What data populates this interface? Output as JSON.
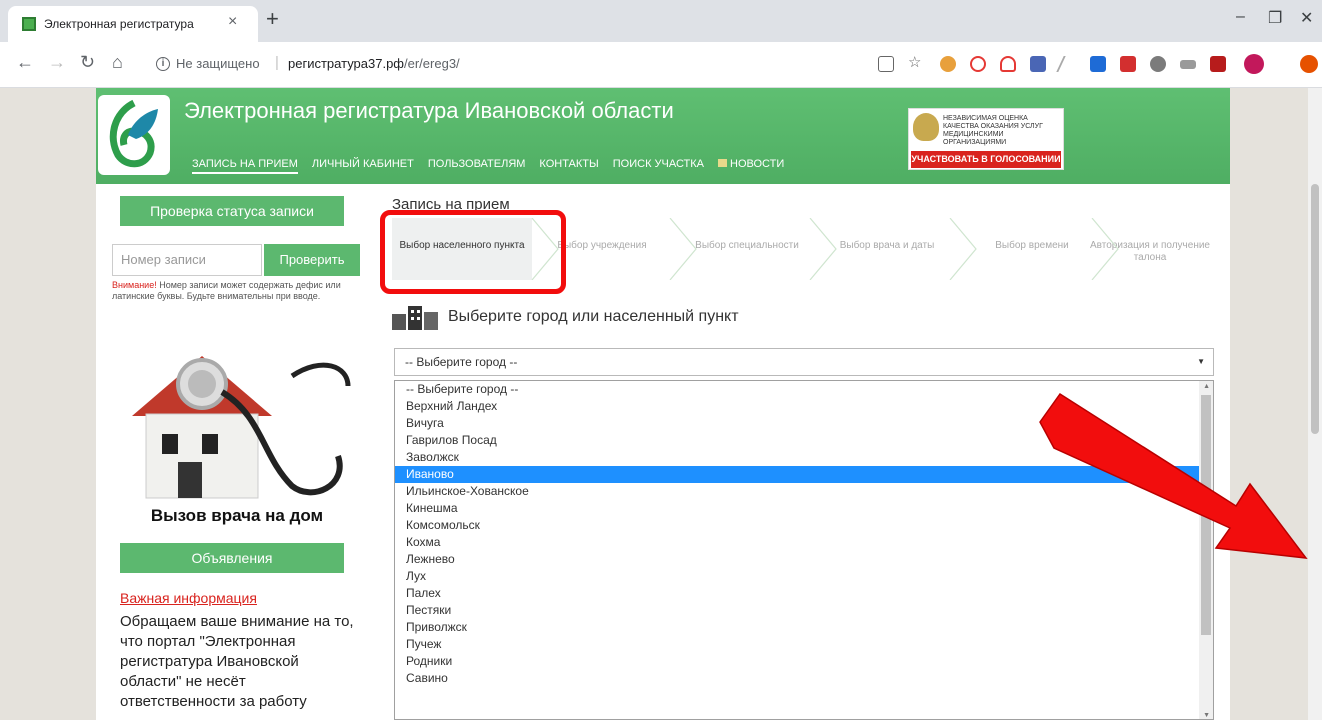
{
  "browser": {
    "tab_title": "Электронная регистратура",
    "tab_close": "×",
    "new_tab": "+",
    "security_label": "Не защищено",
    "url_domain": "регистратура37.рф",
    "url_path": "/er/ereg3/",
    "window_controls": [
      "–",
      "❐",
      "✕"
    ],
    "nav": {
      "back": "←",
      "forward": "→",
      "reload": "↻",
      "home": "⌂"
    }
  },
  "header": {
    "title": "Электронная регистратура Ивановской области",
    "nav": [
      {
        "label": "ЗАПИСЬ НА ПРИЕМ",
        "active": true
      },
      {
        "label": "ЛИЧНЫЙ КАБИНЕТ"
      },
      {
        "label": "ПОЛЬЗОВАТЕЛЯМ"
      },
      {
        "label": "КОНТАКТЫ"
      },
      {
        "label": "ПОИСК УЧАСТКА"
      },
      {
        "label": "НОВОСТИ"
      }
    ],
    "vote": {
      "text": "НЕЗАВИСИМАЯ ОЦЕНКА КАЧЕСТВА ОКАЗАНИЯ УСЛУГ МЕДИЦИНСКИМИ ОРГАНИЗАЦИЯМИ",
      "button": "УЧАСТВОВАТЬ В ГОЛОСОВАНИИ"
    }
  },
  "sidebar": {
    "status_heading": "Проверка статуса записи",
    "record_placeholder": "Номер записи",
    "check_button": "Проверить",
    "warning_lead": "Внимание!",
    "warning_text": " Номер записи может содержать дефис или латинские буквы. Будьте внимательны при вводе.",
    "house_caption": "Вызов врача на дом",
    "ads_heading": "Объявления",
    "ad_link": "Важная информация",
    "ad_text": "Обращаем ваше внимание на то, что портал \"Электронная регистратура Ивановской области\" не несёт ответственности за работу"
  },
  "main": {
    "title": "Запись на прием",
    "steps": [
      {
        "label": "Выбор населенного пункта",
        "active": true
      },
      {
        "label": "Выбор учреждения"
      },
      {
        "label": "Выбор специальности"
      },
      {
        "label": "Выбор врача и даты"
      },
      {
        "label": "Выбор времени"
      },
      {
        "label": "Авторизация и получение талона"
      }
    ],
    "section_title": "Выберите город или населенный пункт",
    "select_value": "-- Выберите город --",
    "options": [
      "-- Выберите город --",
      "Верхний Ландех",
      "Вичуга",
      "Гаврилов Посад",
      "Заволжск",
      "Иваново",
      "Ильинское-Хованское",
      "Кинешма",
      "Комсомольск",
      "Кохма",
      "Лежнево",
      "Лух",
      "Палех",
      "Пестяки",
      "Приволжск",
      "Пучеж",
      "Родники",
      "Савино"
    ],
    "selected_option": "Иваново"
  },
  "colors": {
    "brand_green": "#5cb86f",
    "highlight_red": "#f20d0d",
    "selected_blue": "#1e90ff"
  }
}
